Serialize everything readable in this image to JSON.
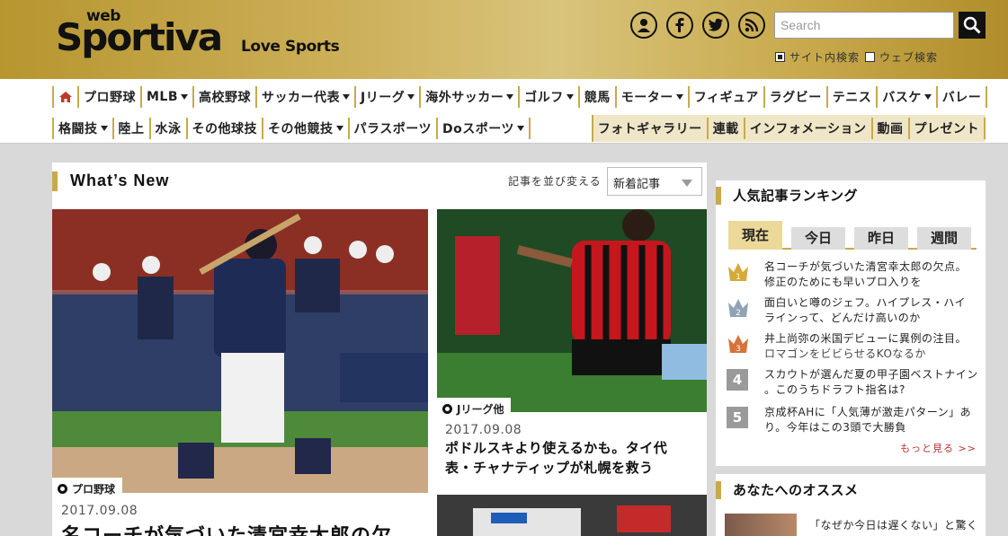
{
  "header": {
    "logo_web": "web",
    "logo_brand": "Sportiva",
    "logo_tagline": "Love Sports",
    "social": [
      "user-icon",
      "facebook-icon",
      "twitter-icon",
      "rss-icon"
    ],
    "search_placeholder": "Search",
    "search_scope": [
      {
        "label": "サイト内検索",
        "checked": true
      },
      {
        "label": "ウェブ検索",
        "checked": false
      }
    ]
  },
  "nav": {
    "row1": [
      {
        "label": "",
        "icon": "home-icon",
        "dropdown": false
      },
      {
        "label": "プロ野球",
        "dropdown": false
      },
      {
        "label": "MLB",
        "dropdown": true
      },
      {
        "label": "高校野球",
        "dropdown": false
      },
      {
        "label": "サッカー代表",
        "dropdown": true
      },
      {
        "label": "Jリーグ",
        "dropdown": true
      },
      {
        "label": "海外サッカー",
        "dropdown": true
      },
      {
        "label": "ゴルフ",
        "dropdown": true
      },
      {
        "label": "競馬",
        "dropdown": false
      },
      {
        "label": "モーター",
        "dropdown": true
      },
      {
        "label": "フィギュア",
        "dropdown": false
      },
      {
        "label": "ラグビー",
        "dropdown": false
      },
      {
        "label": "テニス",
        "dropdown": false
      },
      {
        "label": "バスケ",
        "dropdown": true
      },
      {
        "label": "バレー",
        "dropdown": false
      }
    ],
    "row2": [
      {
        "label": "格闘技",
        "dropdown": true
      },
      {
        "label": "陸上",
        "dropdown": false
      },
      {
        "label": "水泳",
        "dropdown": false
      },
      {
        "label": "その他球技",
        "dropdown": false
      },
      {
        "label": "その他競技",
        "dropdown": true
      },
      {
        "label": "パラスポーツ",
        "dropdown": false
      },
      {
        "label": "Doスポーツ",
        "dropdown": true
      }
    ],
    "row2_right": [
      {
        "label": "フォトギャラリー"
      },
      {
        "label": "連載"
      },
      {
        "label": "インフォメーション"
      },
      {
        "label": "動画"
      },
      {
        "label": "プレゼント"
      }
    ]
  },
  "main": {
    "title": "What’s New",
    "sort_label": "記事を並び変える",
    "sort_value": "新着記事",
    "articles": [
      {
        "category": "プロ野球",
        "date": "2017.09.08",
        "headline": "名コーチが気づいた清宮幸太郎の欠"
      },
      {
        "category": "Jリーグ他",
        "date": "2017.09.08",
        "headline_l1": "ポドルスキより使えるかも。タイ代",
        "headline_l2": "表・チャナティップが札幌を救う"
      }
    ]
  },
  "ranking": {
    "title": "人気記事ランキング",
    "tabs": [
      "現在",
      "今日",
      "昨日",
      "週間"
    ],
    "active_tab": 0,
    "items": [
      {
        "rank": "1",
        "l1": "名コーチが気づいた清宮幸太郎の欠点。",
        "l2": "修正のためにも早いプロ入りを",
        "medal": "#d4a93a"
      },
      {
        "rank": "2",
        "l1": "面白いと噂のジェフ。ハイプレス・ハイ",
        "l2": "ラインって、どんだけ高いのか",
        "medal": "#8fa3b5"
      },
      {
        "rank": "3",
        "l1": "井上尚弥の米国デビューに異例の注目。",
        "l2": "ロマゴンをビビらせるKOなるか",
        "medal": "#d4733a"
      },
      {
        "rank": "4",
        "l1": "スカウトが選んだ夏の甲子園ベストナイン",
        "l2": "。このうちドラフト指名は?"
      },
      {
        "rank": "5",
        "l1": "京成杯AHに「人気薄が激走パターン」あ",
        "l2": "り。今年はこの3頭で大勝負"
      }
    ],
    "more": "もっと見る >>"
  },
  "recommend": {
    "title": "あなたへのオススメ",
    "item_text": "「なぜか今日は遅くない」と驚く"
  },
  "colors": {
    "gold": "#c8a94c",
    "accent_red": "#b33"
  }
}
